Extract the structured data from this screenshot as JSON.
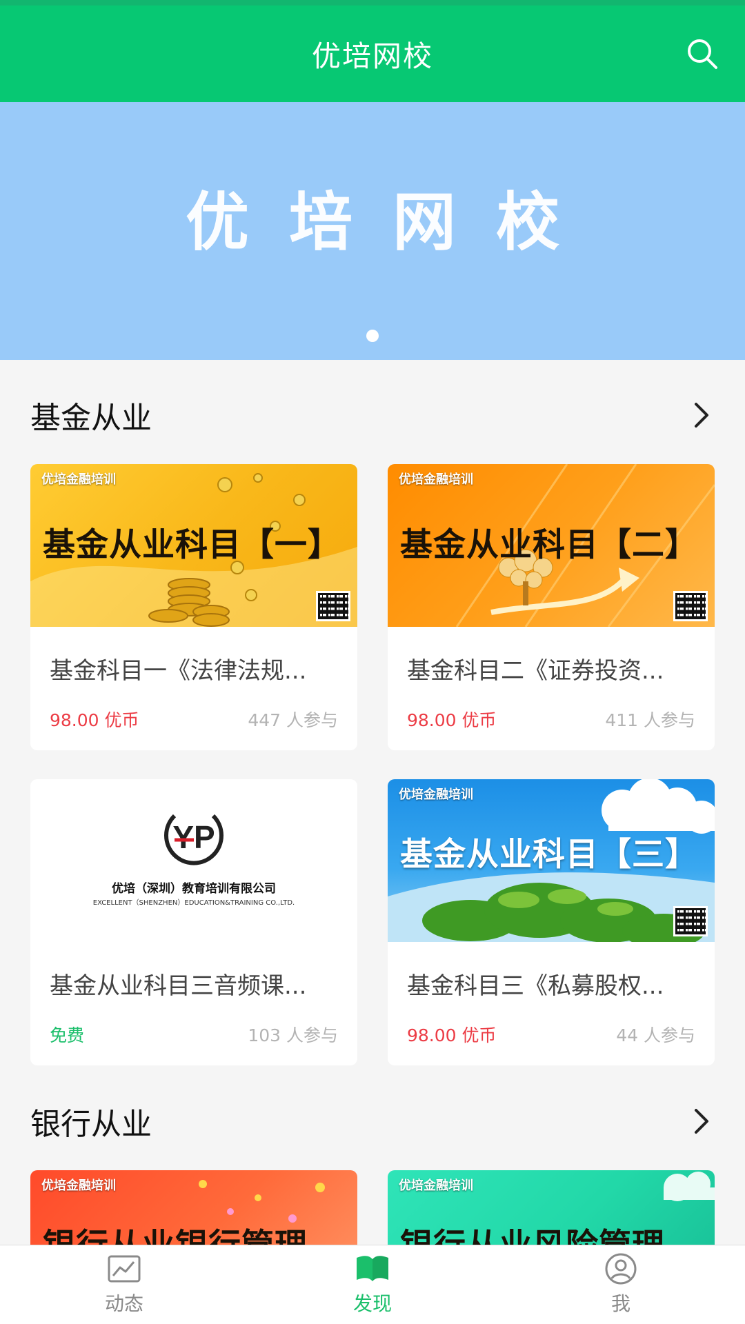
{
  "app": {
    "title": "优培网校"
  },
  "banner": {
    "text": "优培网校",
    "slides": 1,
    "active_slide": 1
  },
  "sections": [
    {
      "title": "基金从业",
      "courses": [
        {
          "thumb_brand": "优培金融培训",
          "thumb_headline": "基金从业科目【一】",
          "title": "基金科目一《法律法规...",
          "price": "98.00 优币",
          "participants": "447 人参与",
          "theme": "gold"
        },
        {
          "thumb_brand": "优培金融培训",
          "thumb_headline": "基金从业科目【二】",
          "title": "基金科目二《证券投资...",
          "price": "98.00 优币",
          "participants": "411 人参与",
          "theme": "orange"
        },
        {
          "thumb_logo": "YP",
          "thumb_company_cn": "优培（深圳）教育培训有限公司",
          "thumb_company_en": "EXCELLENT（SHENZHEN）EDUCATION&TRAINING CO.,LTD.",
          "title": "基金从业科目三音频课...",
          "price": "免费",
          "participants": "103 人参与",
          "theme": "white"
        },
        {
          "thumb_brand": "优培金融培训",
          "thumb_headline": "基金从业科目【三】",
          "title": "基金科目三《私募股权...",
          "price": "98.00 优币",
          "participants": "44 人参与",
          "theme": "sky"
        }
      ]
    },
    {
      "title": "银行从业",
      "courses": [
        {
          "thumb_brand": "优培金融培训",
          "thumb_headline": "银行从业银行管理",
          "theme": "red"
        },
        {
          "thumb_brand": "优培金融培训",
          "thumb_headline": "银行从业风险管理",
          "theme": "teal"
        }
      ]
    }
  ],
  "bottom_nav": [
    {
      "label": "动态",
      "icon": "chart-icon",
      "active": false
    },
    {
      "label": "发现",
      "icon": "book-icon",
      "active": true
    },
    {
      "label": "我",
      "icon": "user-icon",
      "active": false
    }
  ],
  "colors": {
    "primary": "#07c873",
    "price": "#ec3b44",
    "free": "#1bbf6b",
    "banner": "#99caf9"
  }
}
